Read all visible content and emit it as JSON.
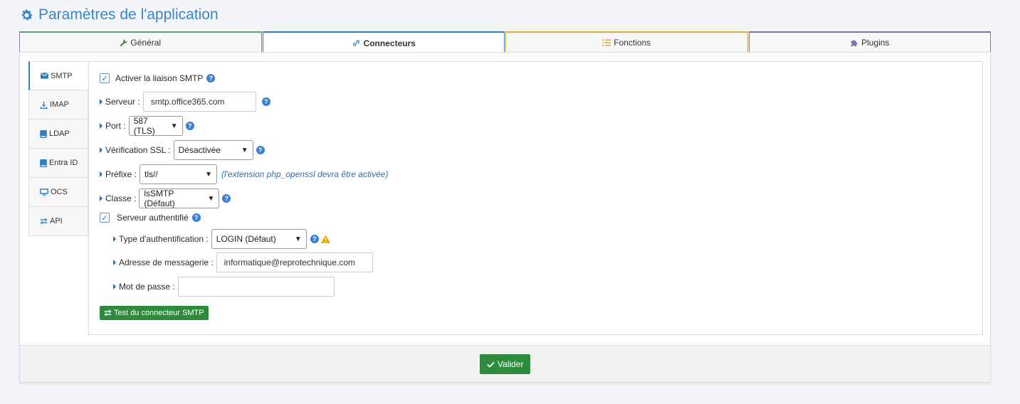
{
  "page": {
    "title": "Paramètres de l'application"
  },
  "tabs": [
    {
      "label": "Général",
      "icon": "wrench-icon",
      "color": "#5aa469"
    },
    {
      "label": "Connecteurs",
      "icon": "link-icon",
      "color": "#2f7fc1"
    },
    {
      "label": "Fonctions",
      "icon": "list-icon",
      "color": "#e8a93c"
    },
    {
      "label": "Plugins",
      "icon": "puzzle-icon",
      "color": "#7a6fb8"
    }
  ],
  "side_tabs": [
    {
      "label": "SMTP",
      "icon": "envelope-icon"
    },
    {
      "label": "IMAP",
      "icon": "download-icon"
    },
    {
      "label": "LDAP",
      "icon": "book-icon"
    },
    {
      "label": "Entra ID",
      "icon": "book-icon"
    },
    {
      "label": "OCS",
      "icon": "monitor-icon"
    },
    {
      "label": "API",
      "icon": "exchange-icon"
    }
  ],
  "smtp": {
    "enable_label": "Activer la liaison SMTP",
    "server_label": "Serveur :",
    "server_value": "smtp.office365.com",
    "port_label": "Port :",
    "port_value": "587 (TLS)",
    "ssl_label": "Vérification SSL :",
    "ssl_value": "Désactivée",
    "prefix_label": "Préfixe :",
    "prefix_value": "tls//",
    "prefix_note": "(l'extension php_openssl devra être activée)",
    "class_label": "Classe :",
    "class_value": "lsSMTP (Défaut)",
    "auth_label": "Serveur authentifié",
    "auth_type_label": "Type d'authentification :",
    "auth_type_value": "LOGIN (Défaut)",
    "email_label": "Adresse de messagerie :",
    "email_value": "informatique@reprotechnique.com",
    "password_label": "Mot de passe :",
    "password_value": "",
    "test_button": "Test du connecteur SMTP"
  },
  "footer": {
    "submit_label": "Valider"
  },
  "colors": {
    "accent": "#3a86c8",
    "button_green": "#2e8b3b"
  }
}
